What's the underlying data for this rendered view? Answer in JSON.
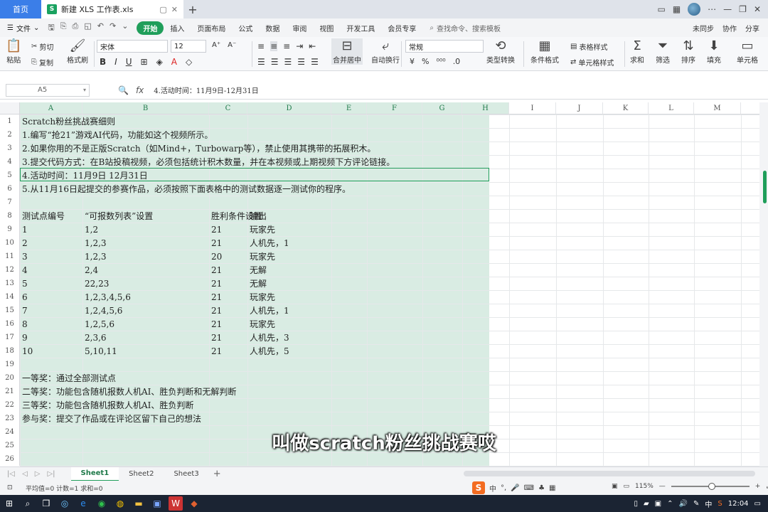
{
  "tabbar": {
    "home_label": "首页",
    "doc_tab_icon": "S",
    "doc_tab_title": "新建 XLS 工作表.xls",
    "new_tab": "+"
  },
  "menubar": {
    "file_label": "文件",
    "items": [
      "开始",
      "插入",
      "页面布局",
      "公式",
      "数据",
      "审阅",
      "视图",
      "开发工具",
      "会员专享"
    ],
    "search_label": "查找命令、搜索模板",
    "right_items": [
      "未同步",
      "协作",
      "分享"
    ]
  },
  "ribbon": {
    "cut": "剪切",
    "copy": "复制",
    "paste": "粘贴",
    "format_painter": "格式刷",
    "font_name": "宋体",
    "font_size": "12",
    "bold": "B",
    "italic": "I",
    "underline": "U",
    "merge_center": "合并居中",
    "wrap_text": "自动换行",
    "number_format": "常规",
    "type_convert": "类型转换",
    "conditional_format": "条件格式",
    "table_style": "表格样式",
    "cell_style": "单元格样式",
    "sum": "求和",
    "filter": "筛选",
    "sort": "排序",
    "fill": "填充",
    "cell": "单元格"
  },
  "formulabar": {
    "cell_ref": "A5",
    "fx": "fx",
    "content": "4.活动时间：11月9日-12月31日"
  },
  "grid": {
    "columns": [
      "A",
      "B",
      "C",
      "D",
      "E",
      "F",
      "G",
      "H",
      "I",
      "J",
      "K",
      "L",
      "M",
      "N"
    ],
    "row_numbers": [
      "1",
      "2",
      "3",
      "4",
      "5",
      "6",
      "7",
      "8",
      "9",
      "10",
      "11",
      "12",
      "13",
      "14",
      "15",
      "16",
      "17",
      "18",
      "19",
      "20",
      "21",
      "22",
      "23",
      "24",
      "25",
      "26"
    ],
    "text_rows": {
      "r1": "Scratch粉丝挑战赛细则",
      "r2": "1.编写“抢21”游戏AI代码，功能如这个视频所示。",
      "r3": "2.如果你用的不是正版Scratch（如Mind+，Turbowarp等），禁止使用其携带的拓展积木。",
      "r4": "3.提交代码方式：在B站投稿视频，必须包括统计积木数量，并在本视频或上期视频下方评论链接。",
      "r5": "4.活动时间：11月9日 12月31日",
      "r6": "5.从11月16日起提交的参赛作品，必须按照下面表格中的测试数据逐一测试你的程序。",
      "r20": "一等奖：通过全部测试点",
      "r21": "二等奖：功能包含随机报数人机AI、胜负判断和无解判断",
      "r22": "三等奖：功能包含随机报数人机AI、胜负判断",
      "r23": "参与奖：提交了作品或在评论区留下自己的想法"
    },
    "table_header": [
      "测试点编号",
      "“可报数列表”设置",
      "胜利条件设置",
      "输出"
    ],
    "table_rows": [
      [
        "1",
        "1,2",
        "21",
        "玩家先"
      ],
      [
        "2",
        "1,2,3",
        "21",
        "人机先，1"
      ],
      [
        "3",
        "1,2,3",
        "20",
        "玩家先"
      ],
      [
        "4",
        "2,4",
        "21",
        "无解"
      ],
      [
        "5",
        "22,23",
        "21",
        "无解"
      ],
      [
        "6",
        "1,2,3,4,5,6",
        "21",
        "玩家先"
      ],
      [
        "7",
        "1,2,4,5,6",
        "21",
        "人机先，1"
      ],
      [
        "8",
        "1,2,5,6",
        "21",
        "玩家先"
      ],
      [
        "9",
        "2,3,6",
        "21",
        "人机先，3"
      ],
      [
        "10",
        "5,10,11",
        "21",
        "人机先，5"
      ]
    ]
  },
  "sheets": {
    "tabs": [
      "Sheet1",
      "Sheet2",
      "Sheet3"
    ],
    "active": "Sheet1",
    "add": "+"
  },
  "statusbar": {
    "summary": "平均值=0  计数=1  求和=0",
    "ime_logo": "S",
    "ime_lang": "中",
    "zoom": "115%"
  },
  "taskbar": {
    "ime": "中",
    "time": "12:04"
  },
  "subtitle": "叫做scratch粉丝挑战赛哎",
  "colors": {
    "accent": "#1f9e5a",
    "selection": "#d9ece3",
    "home_tab": "#3b7ee8",
    "taskbar": "#1b2433"
  }
}
